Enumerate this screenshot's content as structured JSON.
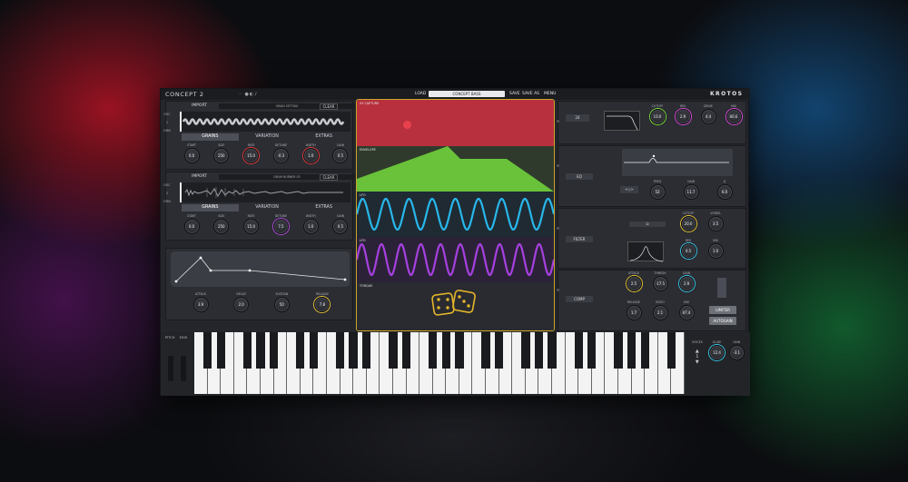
{
  "app": {
    "title": "CONCEPT 2",
    "brand": "KROTOS",
    "load_label": "LOAD",
    "preset_name": "CONCEPT BASS",
    "save_label": "SAVE",
    "save_as_label": "SAVE AS",
    "menu_label": "MENU"
  },
  "osc": [
    {
      "import_label": "IMPORT",
      "sample_name": "GRAIN SETTING",
      "clear_label": "CLEAR",
      "side": [
        "OSC",
        "1",
        "GRN"
      ],
      "tabs": [
        "GRAINS",
        "VARIATION",
        "EXTRAS"
      ],
      "knobs": [
        {
          "label": "START",
          "value": "0.0"
        },
        {
          "label": "SIZE",
          "value": "250"
        },
        {
          "label": "RATE",
          "value": "15.0"
        },
        {
          "label": "DETUNE",
          "value": "-0.3"
        },
        {
          "label": "WIDTH",
          "value": "1.0"
        },
        {
          "label": "GAIN",
          "value": "0.5"
        }
      ]
    },
    {
      "import_label": "IMPORT",
      "sample_name": "DRUM BURNER 03",
      "clear_label": "CLEAR",
      "side": [
        "OSC",
        "2",
        "GRN"
      ],
      "tabs": [
        "GRAINS",
        "VARIATION",
        "EXTRAS"
      ],
      "knobs": [
        {
          "label": "START",
          "value": "0.0"
        },
        {
          "label": "SIZE",
          "value": "250"
        },
        {
          "label": "RATE",
          "value": "15.0"
        },
        {
          "label": "DETUNE",
          "value": "7.5"
        },
        {
          "label": "WIDTH",
          "value": "1.0"
        },
        {
          "label": "GAIN",
          "value": "0.5"
        }
      ]
    }
  ],
  "envelope": {
    "knobs": [
      {
        "label": "ATTACK",
        "value": "3.9"
      },
      {
        "label": "DECAY",
        "value": "2.0"
      },
      {
        "label": "SUSTAIN",
        "value": "50"
      },
      {
        "label": "RELEASE",
        "value": "7.8"
      }
    ]
  },
  "mod": {
    "xy_title": "XY CAPTURE",
    "env_title": "ENVELOPE",
    "lfo1_title": "LFO",
    "lfo2_title": "LFO",
    "random_title": "TORQUE",
    "colors": {
      "xy": "#c0313f",
      "env": "#6dc93a",
      "lfo1": "#2ab8e8",
      "lfo2": "#a63fe0",
      "random": "#e4b52a"
    }
  },
  "right": {
    "unison_value": "24",
    "top_knobs": [
      {
        "label": "CUTOFF",
        "value": "10.0"
      },
      {
        "label": "RES",
        "value": "2.9"
      },
      {
        "label": "DRIVE",
        "value": "4.4"
      },
      {
        "label": "MIX",
        "value": "80.6"
      }
    ],
    "eq_label": "EQ",
    "eq_knobs": [
      {
        "label": "FREQ",
        "value": "52"
      },
      {
        "label": "GAIN",
        "value": "11.7"
      },
      {
        "label": "Q",
        "value": "6.0"
      }
    ],
    "filter_label": "FILTER",
    "filter_knobs": [
      {
        "label": "CUTOFF",
        "value": "20.0"
      },
      {
        "label": "VOWEL",
        "value": "3.5"
      },
      {
        "label": "RES",
        "value": "0.5"
      },
      {
        "label": "MIX",
        "value": "1.0"
      }
    ],
    "comp_label": "COMP",
    "comp_knobs": [
      {
        "label": "ATTACK",
        "value": "2.5"
      },
      {
        "label": "THRESH",
        "value": "-17.5"
      },
      {
        "label": "GAIN",
        "value": "2.9"
      },
      {
        "label": "RELEASE",
        "value": "1.7"
      },
      {
        "label": "RATIO",
        "value": "2.1"
      },
      {
        "label": "MIX",
        "value": "87.4"
      }
    ],
    "limiter_label": "LIMITER",
    "autogain_label": "AUTOGAIN"
  },
  "keyboard": {
    "pitch_label": "PITCH",
    "mod_label": "MOD",
    "voices_label": "VOICES",
    "voices_value": "1",
    "glide_label": "GLIDE",
    "glide_value": "12.4",
    "gain_label": "GAIN",
    "gain_value": "-3.1"
  }
}
